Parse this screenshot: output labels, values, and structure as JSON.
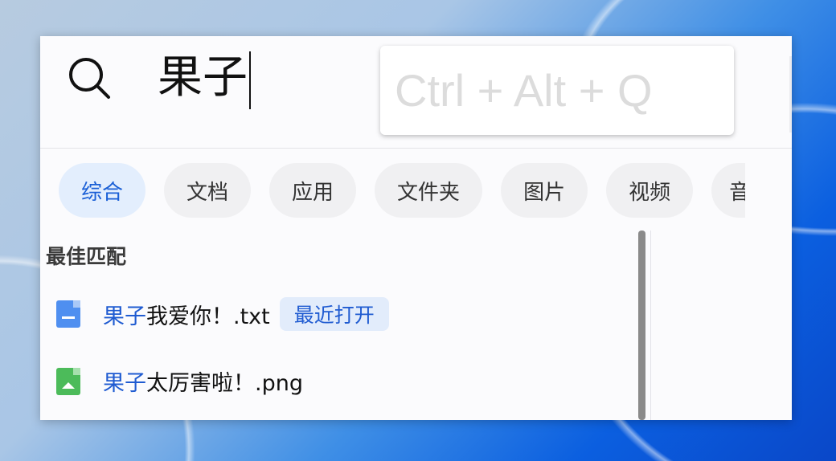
{
  "search": {
    "query": "果子",
    "hotkey_placeholder": "Ctrl + Alt + Q"
  },
  "tabs": [
    {
      "label": "综合",
      "active": true
    },
    {
      "label": "文档"
    },
    {
      "label": "应用"
    },
    {
      "label": "文件夹"
    },
    {
      "label": "图片"
    },
    {
      "label": "视频"
    },
    {
      "label": "音"
    }
  ],
  "best_match": {
    "title": "最佳匹配",
    "results": [
      {
        "highlight": "果子",
        "rest": "我爱你！.txt",
        "badge": "最近打开",
        "icon": "txt-file-icon"
      },
      {
        "highlight": "果子",
        "rest": "太厉害啦！.png",
        "icon": "image-file-icon"
      }
    ]
  },
  "colors": {
    "accent": "#1f5bd1"
  }
}
